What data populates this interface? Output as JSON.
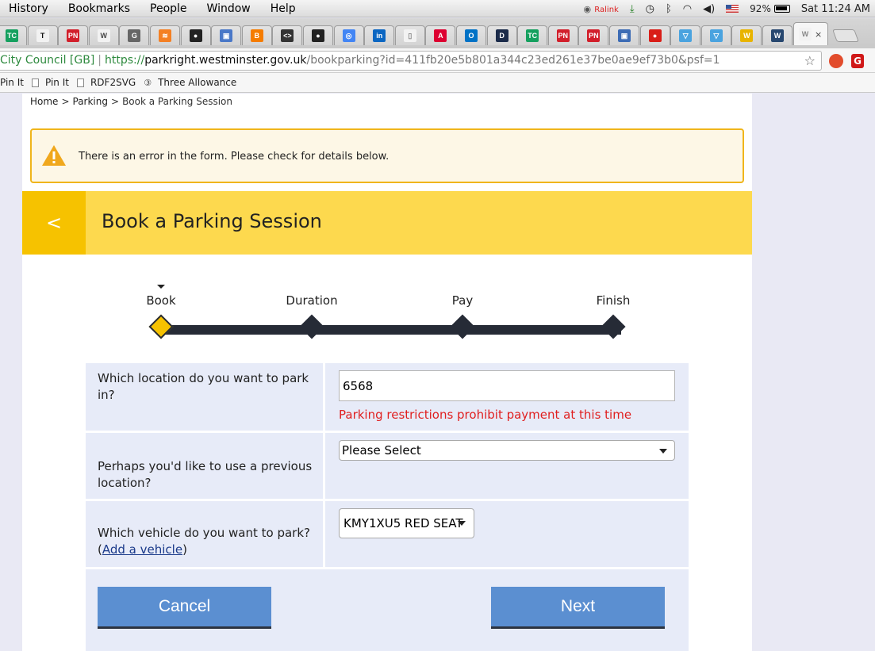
{
  "menubar": {
    "items": [
      "History",
      "Bookmarks",
      "People",
      "Window",
      "Help"
    ],
    "status": {
      "ralink": "Ralink",
      "battery": "92%",
      "clock": "Sat 11:24 AM"
    }
  },
  "tabs": [
    {
      "icon": "tc",
      "color": "#15a05f"
    },
    {
      "icon": "nyt",
      "color": "#111111"
    },
    {
      "icon": "pn",
      "color": "#d21f2b"
    },
    {
      "icon": "wikipedia",
      "color": "#444444"
    },
    {
      "icon": "generic",
      "color": "#666666"
    },
    {
      "icon": "stackoverflow",
      "color": "#f48024"
    },
    {
      "icon": "github",
      "color": "#222222"
    },
    {
      "icon": "generic-blue",
      "color": "#4a78c8"
    },
    {
      "icon": "blogger",
      "color": "#f57c00"
    },
    {
      "icon": "code",
      "color": "#333333"
    },
    {
      "icon": "github",
      "color": "#222222"
    },
    {
      "icon": "google",
      "color": "#4285f4"
    },
    {
      "icon": "linkedin",
      "color": "#0a66c2"
    },
    {
      "icon": "document",
      "color": "#888888"
    },
    {
      "icon": "angular",
      "color": "#dd0031"
    },
    {
      "icon": "outlook",
      "color": "#0072c6"
    },
    {
      "icon": "d",
      "color": "#1b2b4a"
    },
    {
      "icon": "tc",
      "color": "#15a05f"
    },
    {
      "icon": "pn",
      "color": "#d21f2b"
    },
    {
      "icon": "pn",
      "color": "#d21f2b"
    },
    {
      "icon": "generic-blue",
      "color": "#3d6cb5"
    },
    {
      "icon": "red-circle",
      "color": "#d91e18"
    },
    {
      "icon": "funnel",
      "color": "#4aa3df"
    },
    {
      "icon": "funnel",
      "color": "#4aa3df"
    },
    {
      "icon": "w-yellow",
      "color": "#e8b400"
    },
    {
      "icon": "w-blue",
      "color": "#27476f"
    },
    {
      "icon": "w-active",
      "color": "#888888"
    }
  ],
  "address": {
    "org": "City Council [GB]",
    "scheme": "https://",
    "host": "parkright.westminster.gov.uk",
    "path": "/bookparking?id=411fb20e5b801a344c23ed261e37be0ae9ef73b0&psf=1"
  },
  "bookmarks": [
    "Pin It",
    "Pin It",
    "RDF2SVG",
    "Three Allowance"
  ],
  "breadcrumb": {
    "home": "Home",
    "parking": "Parking",
    "current": "Book a Parking Session",
    "sep": ">"
  },
  "error_banner": {
    "message": "There is an error in the form. Please check for details below."
  },
  "header": {
    "back": "<",
    "title": "Book a Parking Session"
  },
  "steps": {
    "current_index": 0,
    "items": [
      "Book",
      "Duration",
      "Pay",
      "Finish"
    ]
  },
  "form": {
    "location": {
      "question": "Which location do you want to park in?",
      "value": "6568",
      "error": "Parking restrictions prohibit payment at this time"
    },
    "previous_location": {
      "question": "Perhaps you'd like to use a previous location?",
      "selected": "Please Select"
    },
    "vehicle": {
      "question": "Which vehicle do you want to park?",
      "add_prefix": "(",
      "add_link": "Add a vehicle",
      "add_suffix": ")",
      "selected": "KMY1XU5 RED SEAT"
    }
  },
  "buttons": {
    "cancel": "Cancel",
    "next": "Next"
  }
}
